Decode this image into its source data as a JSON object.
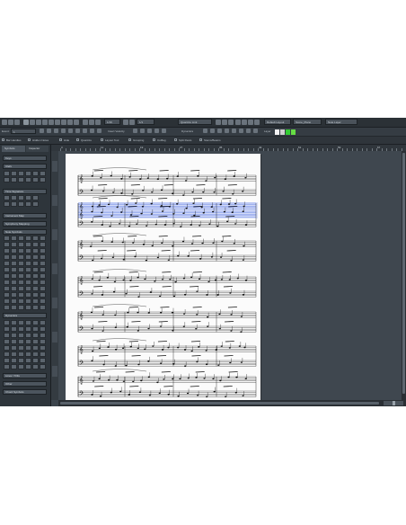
{
  "toolbar": {
    "quantize": "1/16",
    "length_quantize": "1/1",
    "display_quantize": "Quantize Link",
    "insert_velocity": "Insert Velocity",
    "dynamics_label": "Dynamics",
    "layer_label": "Layer",
    "default_layout": "Default Layout",
    "layout_page": "Score_Piano",
    "note_layer": "Note Layer"
  },
  "toolbar2": {
    "event_label": "Event:",
    "event_value": "1"
  },
  "options_bar": {
    "items": [
      "Bar Handles",
      "Hidden Notes",
      "Hide",
      "Quantize",
      "Layout Tool",
      "Grouping",
      "Cutflag",
      "Split Rests",
      "Stems/Beams"
    ]
  },
  "colors": {
    "layer_colors": [
      "#f2f2f2",
      "#cfcfcf",
      "#33cc33",
      "#66dd44"
    ]
  },
  "left_panel": {
    "tabs": [
      "Symbols",
      "Inspector"
    ],
    "sections": [
      "Keys",
      "Clefs",
      "Time Signature",
      "Instrument Map",
      "Symphony Mapping",
      "Note Symbols",
      "Dynamics",
      "Lines / Trills",
      "Other",
      "Chord Symbols"
    ]
  },
  "ruler": {
    "top_numbers": [
      "3",
      "4",
      "5",
      "6",
      "7",
      "8",
      "9",
      "10",
      "11",
      "12",
      "13",
      "14",
      "15",
      "16",
      "17",
      "18",
      "19",
      "20",
      "21",
      "22",
      "23",
      "24",
      "25",
      "26",
      "27",
      "28",
      "29",
      "30",
      "31",
      "32",
      "33",
      "34",
      "35",
      "36",
      "37",
      "38",
      "39",
      "40",
      "41",
      "42",
      "43",
      "44",
      "45",
      "46",
      "47",
      "48",
      "49",
      "50",
      "51",
      "52",
      "53",
      "54",
      "55",
      "56",
      "57",
      "58",
      "59",
      "60",
      "61",
      "62",
      "63",
      "64",
      "65",
      "66",
      "67",
      "68",
      "69",
      "70",
      "71",
      "72"
    ],
    "left_numbers": [
      "1",
      "2",
      "3",
      "4",
      "5",
      "6",
      "7"
    ]
  },
  "score": {
    "systems": 7,
    "selected_staff_color": "#3a5ee0"
  }
}
